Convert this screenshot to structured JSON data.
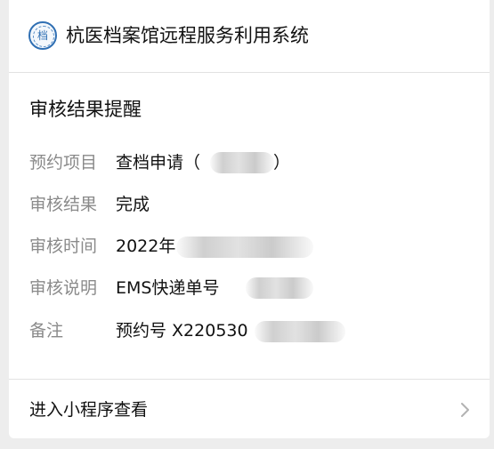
{
  "header": {
    "logo_text": "档",
    "app_title": "杭医档案馆远程服务利用系统"
  },
  "notice": {
    "title": "审核结果提醒",
    "rows": [
      {
        "label": "预约项目",
        "value": "查档申请（",
        "suffix": "）"
      },
      {
        "label": "审核结果",
        "value": "完成"
      },
      {
        "label": "审核时间",
        "value": "2022年"
      },
      {
        "label": "审核说明",
        "value": "EMS快递单号"
      },
      {
        "label": "备注",
        "value": "预约号 X220530"
      }
    ]
  },
  "footer": {
    "link_label": "进入小程序查看",
    "chevron_icon": "chevron-right-icon"
  },
  "colors": {
    "background": "#ededed",
    "card": "#ffffff",
    "label": "#8a8a8a",
    "text": "#111111",
    "logo": "#2f6fb3"
  }
}
